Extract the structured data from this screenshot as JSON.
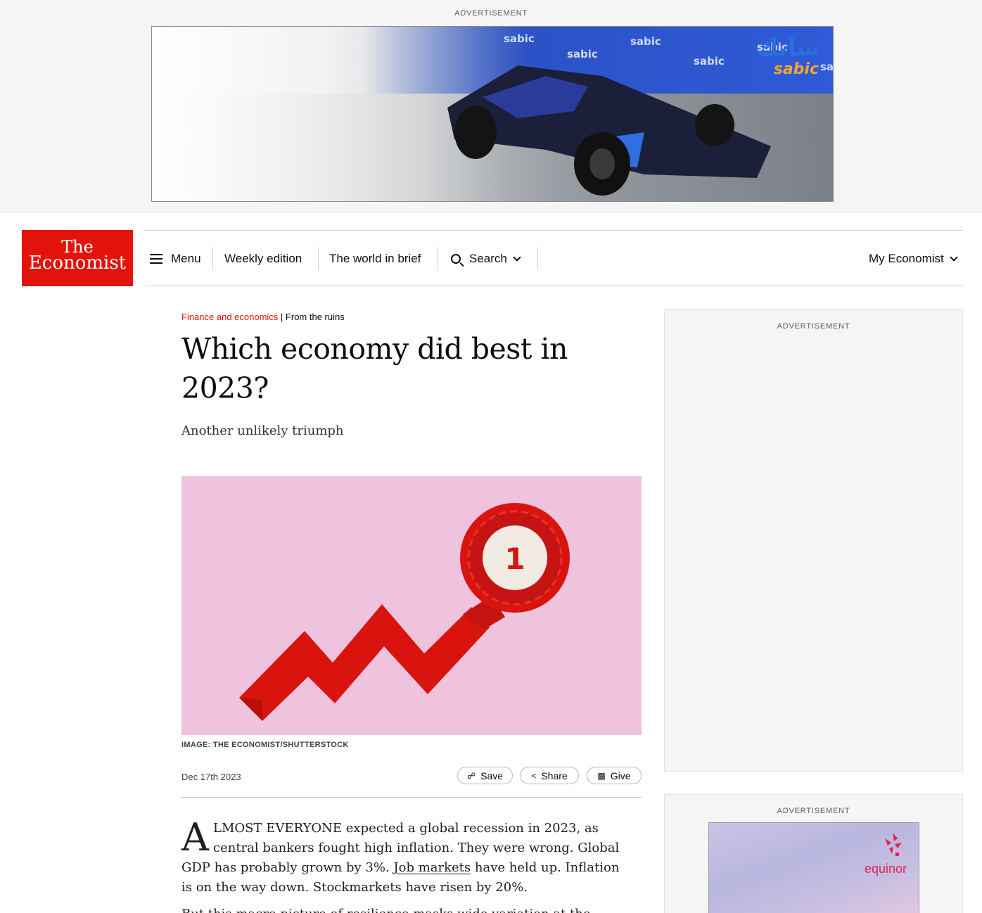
{
  "top_ad": {
    "label": "ADVERTISEMENT",
    "brand_arabic": "سابك",
    "brand_latin": "sabic",
    "wall_text": "sabic"
  },
  "header": {
    "logo_line1": "The",
    "logo_line2": "Economist",
    "nav": {
      "menu": "Menu",
      "weekly": "Weekly edition",
      "world": "The world in brief",
      "search": "Search",
      "my_economist": "My Economist"
    }
  },
  "article": {
    "section": "Finance and economics",
    "separator": " | ",
    "flytitle": "From the ruins",
    "headline": "Which economy did best in 2023?",
    "subhead": "Another unlikely triumph",
    "image_badge": "1",
    "image_credit": "IMAGE: THE ECONOMIST/SHUTTERSTOCK",
    "date": "Dec 17th 2023",
    "actions": {
      "save": "Save",
      "share": "Share",
      "give": "Give"
    },
    "body": {
      "dropcap": "A",
      "lead_smallcaps": "LMOST EVERYONE",
      "text_a": " expected a global recession in 2023, as central bankers fought high inflation. They were wrong. Global ",
      "gdp": "GDP",
      "text_b": " has probably grown by 3%. ",
      "link": "Job markets",
      "text_c": " have held up. Inflation is on the way down. Stockmarkets have risen by 20%.",
      "next_line": "But this macro picture of resilience masks wide variation at the country level."
    }
  },
  "sidebar": {
    "ad1_label": "ADVERTISEMENT",
    "ad2_label": "ADVERTISEMENT",
    "ad2_brand": "equinor"
  },
  "colors": {
    "brand_red": "#e3120b",
    "hero_pink": "#efc3dd",
    "ribbon_red": "#d9140f",
    "sabic_blue": "#2a6fdb",
    "sabic_orange": "#f2a531",
    "equinor_red": "#e02450"
  }
}
